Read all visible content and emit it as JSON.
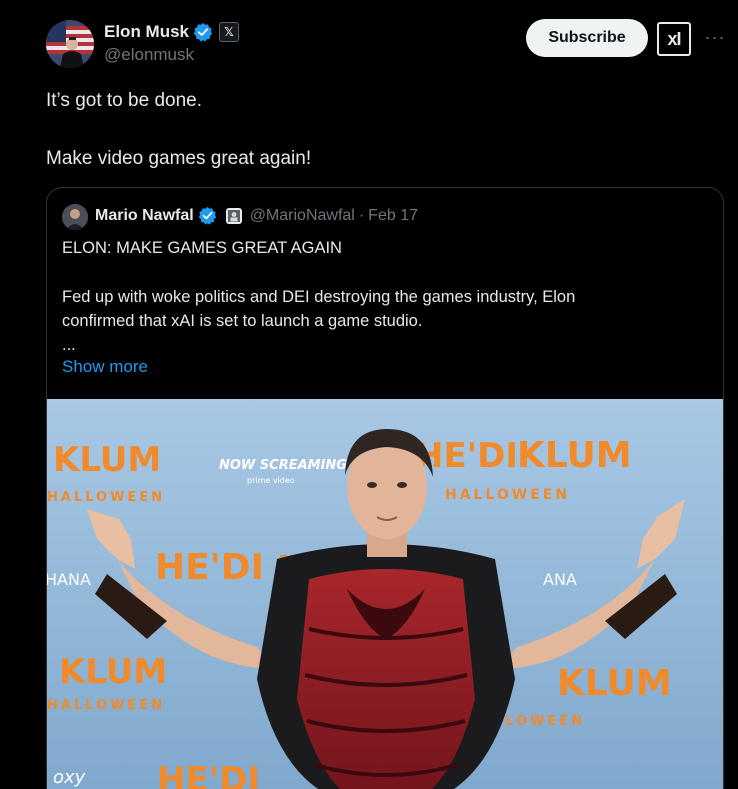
{
  "author": {
    "name": "Elon Musk",
    "handle": "@elonmusk"
  },
  "actions": {
    "subscribe_label": "Subscribe",
    "grok_label": "xI",
    "more_label": "···"
  },
  "tweet": {
    "lines": [
      "It’s got to be done.",
      "Make video games great again!"
    ]
  },
  "quote": {
    "name": "Mario Nawfal",
    "handle": "@MarioNawfal",
    "separator": "·",
    "date": "Feb 17",
    "headline": "ELON: MAKE GAMES GREAT AGAIN",
    "body_line1": "Fed up with woke politics and DEI destroying the games industry, Elon",
    "body_line2": "confirmed that xAI is set to launch a game studio.",
    "ellipsis": "...",
    "show_more": "Show more"
  },
  "photo": {
    "backdrop_text": {
      "klum": "KLUM",
      "heidi": "HE'DI",
      "halloween": "HALLOWEEN",
      "now_screaming": "NOW SCREAMING",
      "prime_video": "prime video",
      "hana_left": "HANA",
      "hana_right": "ANA",
      "oxy": "oxy"
    }
  },
  "colors": {
    "background": "#000000",
    "text": "#e7e9ea",
    "muted": "#71767b",
    "link": "#1d9bf0",
    "border": "#2f3336",
    "verified": "#1d9bf0",
    "backdrop": "#8fb6d8",
    "orange": "#f08a2b"
  }
}
